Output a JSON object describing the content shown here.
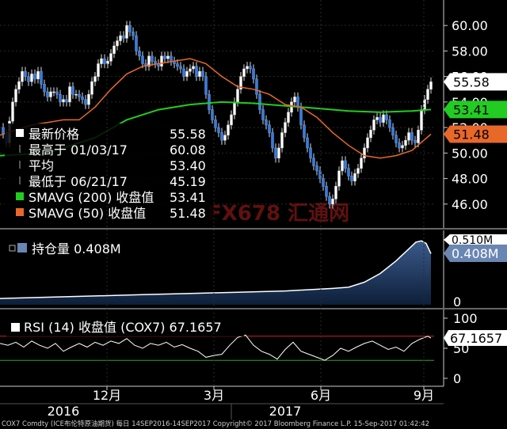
{
  "chart_data": [
    {
      "type": "candlestick",
      "title": "",
      "ylim": [
        44.5,
        61.5
      ],
      "y_ticks": [
        "60.00",
        "58.00",
        "56.00",
        "54.00",
        "52.00",
        "50.00",
        "48.00",
        "46.00"
      ],
      "close_series": [
        [
          0,
          52.0
        ],
        [
          4,
          51.5
        ],
        [
          8,
          50.8
        ],
        [
          12,
          52.5
        ],
        [
          16,
          54.0
        ],
        [
          20,
          55.0
        ],
        [
          24,
          55.6
        ],
        [
          28,
          56.4
        ],
        [
          32,
          56.0
        ],
        [
          36,
          55.6
        ],
        [
          40,
          56.2
        ],
        [
          44,
          55.8
        ],
        [
          48,
          56.4
        ],
        [
          52,
          55.4
        ],
        [
          56,
          54.8
        ],
        [
          60,
          54.4
        ],
        [
          64,
          54.8
        ],
        [
          68,
          54.8
        ],
        [
          72,
          54.6
        ],
        [
          76,
          54.0
        ],
        [
          80,
          54.2
        ],
        [
          84,
          54.0
        ],
        [
          88,
          55.2
        ],
        [
          92,
          54.6
        ],
        [
          96,
          54.6
        ],
        [
          100,
          54.4
        ],
        [
          104,
          54.2
        ],
        [
          108,
          53.8
        ],
        [
          112,
          54.6
        ],
        [
          116,
          55.6
        ],
        [
          120,
          56.0
        ],
        [
          124,
          57.0
        ],
        [
          128,
          57.4
        ],
        [
          132,
          57.0
        ],
        [
          136,
          57.2
        ],
        [
          140,
          57.8
        ],
        [
          144,
          58.4
        ],
        [
          148,
          58.8
        ],
        [
          152,
          59.2
        ],
        [
          156,
          59.0
        ],
        [
          160,
          60.0
        ],
        [
          164,
          59.5
        ],
        [
          168,
          59.2
        ],
        [
          172,
          58.0
        ],
        [
          176,
          57.6
        ],
        [
          180,
          57.0
        ],
        [
          184,
          56.8
        ],
        [
          188,
          57.6
        ],
        [
          192,
          57.2
        ],
        [
          196,
          57.0
        ],
        [
          200,
          56.8
        ],
        [
          204,
          57.6
        ],
        [
          208,
          57.4
        ],
        [
          212,
          57.6
        ],
        [
          216,
          57.2
        ],
        [
          220,
          57.0
        ],
        [
          224,
          56.8
        ],
        [
          228,
          56.6
        ],
        [
          232,
          56.0
        ],
        [
          236,
          56.4
        ],
        [
          240,
          56.6
        ],
        [
          244,
          56.8
        ],
        [
          248,
          56.0
        ],
        [
          252,
          56.4
        ],
        [
          256,
          56.0
        ],
        [
          260,
          54.6
        ],
        [
          264,
          53.4
        ],
        [
          268,
          52.6
        ],
        [
          272,
          52.0
        ],
        [
          276,
          51.6
        ],
        [
          280,
          51.0
        ],
        [
          284,
          51.4
        ],
        [
          288,
          52.2
        ],
        [
          292,
          53.0
        ],
        [
          296,
          54.0
        ],
        [
          300,
          55.0
        ],
        [
          304,
          56.0
        ],
        [
          308,
          56.6
        ],
        [
          312,
          56.8
        ],
        [
          316,
          56.6
        ],
        [
          320,
          55.8
        ],
        [
          324,
          54.6
        ],
        [
          328,
          53.4
        ],
        [
          332,
          52.6
        ],
        [
          336,
          52.2
        ],
        [
          340,
          51.6
        ],
        [
          344,
          50.4
        ],
        [
          348,
          49.6
        ],
        [
          352,
          50.4
        ],
        [
          356,
          51.6
        ],
        [
          360,
          52.4
        ],
        [
          364,
          53.2
        ],
        [
          368,
          54.0
        ],
        [
          372,
          54.4
        ],
        [
          376,
          53.6
        ],
        [
          380,
          52.2
        ],
        [
          384,
          51.2
        ],
        [
          388,
          50.4
        ],
        [
          392,
          49.6
        ],
        [
          396,
          49.0
        ],
        [
          400,
          48.6
        ],
        [
          404,
          48.0
        ],
        [
          408,
          47.4
        ],
        [
          412,
          46.6
        ],
        [
          416,
          46.0
        ],
        [
          420,
          46.4
        ],
        [
          424,
          47.4
        ],
        [
          428,
          48.6
        ],
        [
          432,
          49.4
        ],
        [
          436,
          48.8
        ],
        [
          440,
          48.2
        ],
        [
          444,
          47.8
        ],
        [
          448,
          48.4
        ],
        [
          452,
          48.8
        ],
        [
          456,
          49.6
        ],
        [
          460,
          50.4
        ],
        [
          464,
          51.2
        ],
        [
          468,
          51.8
        ],
        [
          472,
          52.6
        ],
        [
          476,
          52.8
        ],
        [
          480,
          52.4
        ],
        [
          484,
          53.0
        ],
        [
          488,
          52.6
        ],
        [
          492,
          52.0
        ],
        [
          496,
          51.4
        ],
        [
          500,
          50.8
        ],
        [
          504,
          50.4
        ],
        [
          508,
          50.6
        ],
        [
          512,
          51.0
        ],
        [
          516,
          51.6
        ],
        [
          520,
          51.0
        ],
        [
          524,
          50.8
        ],
        [
          528,
          51.8
        ],
        [
          532,
          53.4
        ],
        [
          536,
          54.2
        ],
        [
          540,
          55.0
        ],
        [
          544,
          55.58
        ]
      ],
      "series": [
        {
          "name": "SMAVG (200) 收盘值",
          "color": "#22cc22",
          "points": [
            [
              0,
              49.8
            ],
            [
              60,
              50.0
            ],
            [
              120,
              51.2
            ],
            [
              160,
              52.6
            ],
            [
              200,
              53.4
            ],
            [
              240,
              53.8
            ],
            [
              280,
              54.0
            ],
            [
              320,
              53.9
            ],
            [
              360,
              53.7
            ],
            [
              400,
              53.5
            ],
            [
              440,
              53.3
            ],
            [
              480,
              53.2
            ],
            [
              520,
              53.3
            ],
            [
              544,
              53.41
            ]
          ]
        },
        {
          "name": "SMAVG (50) 收盘值",
          "color": "#e8682a",
          "points": [
            [
              0,
              51.4
            ],
            [
              20,
              51.8
            ],
            [
              40,
              52.2
            ],
            [
              60,
              52.4
            ],
            [
              80,
              52.6
            ],
            [
              100,
              52.6
            ],
            [
              120,
              53.6
            ],
            [
              140,
              55.0
            ],
            [
              160,
              56.2
            ],
            [
              180,
              56.8
            ],
            [
              200,
              57.0
            ],
            [
              220,
              57.2
            ],
            [
              240,
              57.4
            ],
            [
              260,
              57.0
            ],
            [
              280,
              56.0
            ],
            [
              300,
              55.2
            ],
            [
              320,
              55.0
            ],
            [
              340,
              54.6
            ],
            [
              360,
              53.8
            ],
            [
              380,
              53.6
            ],
            [
              400,
              52.8
            ],
            [
              420,
              51.6
            ],
            [
              440,
              50.6
            ],
            [
              460,
              49.8
            ],
            [
              480,
              49.6
            ],
            [
              500,
              49.8
            ],
            [
              520,
              50.2
            ],
            [
              544,
              51.48
            ]
          ]
        }
      ],
      "legend": [
        {
          "label": "最新价格",
          "value": "55.58",
          "color": "#ffffff"
        },
        {
          "label": "最高于 01/03/17",
          "value": "60.08",
          "color": "#cccccc"
        },
        {
          "label": "平均",
          "value": "53.40",
          "color": "#cccccc"
        },
        {
          "label": "最低于 06/21/17",
          "value": "45.19",
          "color": "#cccccc"
        },
        {
          "label": "SMAVG (200) 收盘值",
          "value": "53.41",
          "color": "#22cc22"
        },
        {
          "label": "SMAVG (50) 收盘值",
          "value": "51.48",
          "color": "#e8682a"
        }
      ],
      "right_tags": [
        {
          "value": "55.58",
          "bg": "#ffffff",
          "fg": "#000000"
        },
        {
          "value": "53.41",
          "bg": "#22cc22",
          "fg": "#000000"
        },
        {
          "value": "51.48",
          "bg": "#e8682a",
          "fg": "#000000"
        }
      ],
      "watermark": "FX678 汇通网"
    },
    {
      "type": "area",
      "legend": "持仓量 0.408M",
      "ylim": [
        0,
        0.55
      ],
      "y_ticks": [
        "0"
      ],
      "tags": [
        "0.510M",
        "0.408M"
      ],
      "series": [
        {
          "name": "持仓量",
          "color": "#6688bb",
          "points": [
            [
              0,
              0.05
            ],
            [
              60,
              0.06
            ],
            [
              120,
              0.07
            ],
            [
              180,
              0.08
            ],
            [
              240,
              0.09
            ],
            [
              300,
              0.1
            ],
            [
              360,
              0.11
            ],
            [
              420,
              0.13
            ],
            [
              440,
              0.14
            ],
            [
              460,
              0.18
            ],
            [
              480,
              0.25
            ],
            [
              500,
              0.35
            ],
            [
              515,
              0.44
            ],
            [
              525,
              0.5
            ],
            [
              532,
              0.51
            ],
            [
              538,
              0.49
            ],
            [
              544,
              0.408
            ]
          ]
        }
      ]
    },
    {
      "type": "line",
      "legend": "RSI (14) 收盘值 (COX7) 67.1657",
      "ylim": [
        0,
        100
      ],
      "y_ticks": [
        "100",
        "50",
        "0"
      ],
      "tag": "67.1657",
      "ref_lines": [
        70,
        30
      ],
      "series": [
        {
          "name": "RSI (14)",
          "color": "#ffffff",
          "points": [
            [
              0,
              58
            ],
            [
              10,
              55
            ],
            [
              20,
              60
            ],
            [
              30,
              52
            ],
            [
              40,
              62
            ],
            [
              50,
              55
            ],
            [
              60,
              50
            ],
            [
              70,
              58
            ],
            [
              80,
              45
            ],
            [
              90,
              52
            ],
            [
              100,
              58
            ],
            [
              110,
              52
            ],
            [
              120,
              60
            ],
            [
              130,
              55
            ],
            [
              140,
              62
            ],
            [
              150,
              58
            ],
            [
              160,
              66
            ],
            [
              170,
              55
            ],
            [
              180,
              50
            ],
            [
              190,
              58
            ],
            [
              200,
              55
            ],
            [
              210,
              60
            ],
            [
              220,
              52
            ],
            [
              230,
              56
            ],
            [
              240,
              50
            ],
            [
              250,
              45
            ],
            [
              260,
              35
            ],
            [
              270,
              38
            ],
            [
              280,
              40
            ],
            [
              290,
              55
            ],
            [
              300,
              68
            ],
            [
              310,
              72
            ],
            [
              320,
              55
            ],
            [
              330,
              45
            ],
            [
              340,
              40
            ],
            [
              350,
              32
            ],
            [
              360,
              48
            ],
            [
              370,
              60
            ],
            [
              380,
              45
            ],
            [
              390,
              40
            ],
            [
              400,
              35
            ],
            [
              410,
              30
            ],
            [
              420,
              38
            ],
            [
              430,
              50
            ],
            [
              440,
              45
            ],
            [
              450,
              52
            ],
            [
              460,
              58
            ],
            [
              470,
              62
            ],
            [
              480,
              55
            ],
            [
              490,
              48
            ],
            [
              500,
              52
            ],
            [
              510,
              45
            ],
            [
              520,
              58
            ],
            [
              530,
              65
            ],
            [
              540,
              70
            ],
            [
              544,
              67.1657
            ]
          ]
        }
      ]
    }
  ],
  "x_axis": {
    "months": [
      {
        "label": "12月",
        "pos": 135
      },
      {
        "label": "3月",
        "pos": 270
      },
      {
        "label": "6月",
        "pos": 405
      },
      {
        "label": "9月",
        "pos": 535
      }
    ],
    "years": [
      {
        "label": "2016",
        "pos": 80
      },
      {
        "label": "2017",
        "pos": 360
      }
    ]
  },
  "footer": "COX7 Comdty (ICE布伦特原油期货) 每日 14SEP2016-14SEP2017    Copyright© 2017 Bloomberg Finance L.P.    15-Sep-2017 01:42:42"
}
